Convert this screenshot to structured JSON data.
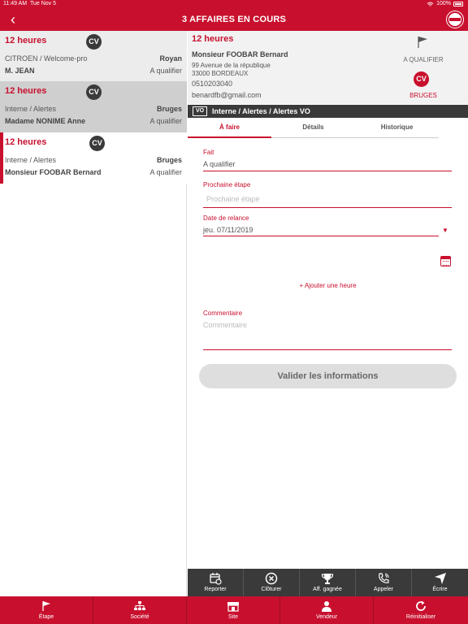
{
  "status_bar": {
    "time": "11:49 AM",
    "date": "Tue Nov 5",
    "battery": "100%"
  },
  "nav": {
    "title": "3 AFFAIRES EN COURS",
    "back_icon": "chevron-left-icon",
    "logo_icon": "nissan-logo-icon"
  },
  "cards": [
    {
      "time": "12 heures",
      "badge": "CV",
      "source": "CITROEN / Welcome-pro",
      "city": "Royan",
      "person": "M. JEAN",
      "status": "A qualifier"
    },
    {
      "time": "12 heures",
      "badge": "CV",
      "source": "Interne / Alertes",
      "city": "Bruges",
      "person": "Madame NONIME Anne",
      "status": "A qualifier"
    },
    {
      "time": "12 heures",
      "badge": "CV",
      "source": "Interne / Alertes",
      "city": "Bruges",
      "person": "Monsieur FOOBAR Bernard",
      "status": "A qualifier"
    }
  ],
  "detail": {
    "time": "12 heures",
    "name": "Monsieur FOOBAR Bernard",
    "address_line1": "99 Avenue de la république",
    "address_line2": "33000 BORDEAUX",
    "phone": "0510203040",
    "email": "benardfb@gmail.com",
    "status_label": "A QUALIFIER",
    "badge": "CV",
    "site": "BRUGES",
    "type_badge": "VO",
    "type_text": "Interne / Alertes / Alertes VO"
  },
  "tabs": [
    "À faire",
    "Détails",
    "Historique"
  ],
  "form": {
    "fait_label": "Fait",
    "fait_value": "A qualifier",
    "etape_label": "Prochaine étape",
    "etape_placeholder": "Prochaine étape",
    "relance_label": "Date de relance",
    "relance_value": "jeu. 07/11/2019",
    "add_hour": "+ Ajouter une heure",
    "comment_label": "Commentaire",
    "comment_placeholder": "Commentaire",
    "submit": "Valider les informations"
  },
  "actions": [
    {
      "label": "Reporter",
      "icon": "calendar-refresh-icon"
    },
    {
      "label": "Clôturer",
      "icon": "close-circle-icon"
    },
    {
      "label": "Aff. gagnée",
      "icon": "trophy-icon"
    },
    {
      "label": "Appeler",
      "icon": "phone-icon"
    },
    {
      "label": "Écrire",
      "icon": "send-icon"
    }
  ],
  "bottom_tabs": [
    {
      "label": "Étape",
      "icon": "flag-icon"
    },
    {
      "label": "Société",
      "icon": "org-chart-icon"
    },
    {
      "label": "Site",
      "icon": "store-icon"
    },
    {
      "label": "Vendeur",
      "icon": "person-icon"
    },
    {
      "label": "Réinitialiser",
      "icon": "refresh-icon"
    }
  ],
  "colors": {
    "brand": "#c8102e",
    "dark": "#3a3a3a",
    "selected_card": "#ffffff"
  }
}
